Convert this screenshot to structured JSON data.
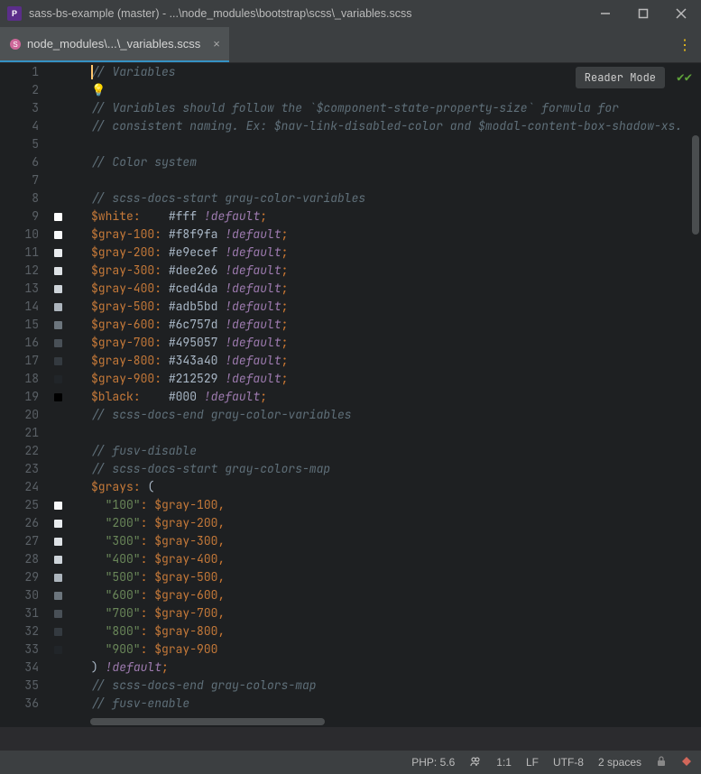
{
  "titlebar": {
    "title": "sass-bs-example (master) - ...\\node_modules\\bootstrap\\scss\\_variables.scss"
  },
  "tab": {
    "label": "node_modules\\...\\_variables.scss"
  },
  "editor": {
    "reader_mode_label": "Reader Mode",
    "lines": [
      {
        "n": 1,
        "type": "comment",
        "text": "// Variables",
        "caret": true
      },
      {
        "n": 2,
        "type": "bulb"
      },
      {
        "n": 3,
        "type": "comment",
        "text": "// Variables should follow the `$component-state-property-size` formula for"
      },
      {
        "n": 4,
        "type": "comment",
        "text": "// consistent naming. Ex: $nav-link-disabled-color and $modal-content-box-shadow-xs."
      },
      {
        "n": 5,
        "type": "blank"
      },
      {
        "n": 6,
        "type": "comment",
        "text": "// Color system"
      },
      {
        "n": 7,
        "type": "blank"
      },
      {
        "n": 8,
        "type": "comment",
        "text": "// scss-docs-start gray-color-variables"
      },
      {
        "n": 9,
        "type": "decl",
        "var": "$white",
        "val": "#fff",
        "swatch": "#ffffff",
        "wide": true
      },
      {
        "n": 10,
        "type": "decl",
        "var": "$gray-100",
        "val": "#f8f9fa",
        "swatch": "#f8f9fa"
      },
      {
        "n": 11,
        "type": "decl",
        "var": "$gray-200",
        "val": "#e9ecef",
        "swatch": "#e9ecef"
      },
      {
        "n": 12,
        "type": "decl",
        "var": "$gray-300",
        "val": "#dee2e6",
        "swatch": "#dee2e6"
      },
      {
        "n": 13,
        "type": "decl",
        "var": "$gray-400",
        "val": "#ced4da",
        "swatch": "#ced4da"
      },
      {
        "n": 14,
        "type": "decl",
        "var": "$gray-500",
        "val": "#adb5bd",
        "swatch": "#adb5bd"
      },
      {
        "n": 15,
        "type": "decl",
        "var": "$gray-600",
        "val": "#6c757d",
        "swatch": "#6c757d"
      },
      {
        "n": 16,
        "type": "decl",
        "var": "$gray-700",
        "val": "#495057",
        "swatch": "#495057"
      },
      {
        "n": 17,
        "type": "decl",
        "var": "$gray-800",
        "val": "#343a40",
        "swatch": "#343a40"
      },
      {
        "n": 18,
        "type": "decl",
        "var": "$gray-900",
        "val": "#212529",
        "swatch": "#212529"
      },
      {
        "n": 19,
        "type": "decl",
        "var": "$black",
        "val": "#000",
        "swatch": "#000000",
        "wide": true
      },
      {
        "n": 20,
        "type": "comment",
        "text": "// scss-docs-end gray-color-variables"
      },
      {
        "n": 21,
        "type": "blank"
      },
      {
        "n": 22,
        "type": "comment",
        "text": "// fusv-disable"
      },
      {
        "n": 23,
        "type": "comment",
        "text": "// scss-docs-start gray-colors-map"
      },
      {
        "n": 24,
        "type": "mapstart",
        "var": "$grays"
      },
      {
        "n": 25,
        "type": "mapentry",
        "key": "100",
        "val": "$gray-100",
        "swatch": "#f8f9fa",
        "comma": true
      },
      {
        "n": 26,
        "type": "mapentry",
        "key": "200",
        "val": "$gray-200",
        "swatch": "#e9ecef",
        "comma": true
      },
      {
        "n": 27,
        "type": "mapentry",
        "key": "300",
        "val": "$gray-300",
        "swatch": "#dee2e6",
        "comma": true
      },
      {
        "n": 28,
        "type": "mapentry",
        "key": "400",
        "val": "$gray-400",
        "swatch": "#ced4da",
        "comma": true
      },
      {
        "n": 29,
        "type": "mapentry",
        "key": "500",
        "val": "$gray-500",
        "swatch": "#adb5bd",
        "comma": true
      },
      {
        "n": 30,
        "type": "mapentry",
        "key": "600",
        "val": "$gray-600",
        "swatch": "#6c757d",
        "comma": true
      },
      {
        "n": 31,
        "type": "mapentry",
        "key": "700",
        "val": "$gray-700",
        "swatch": "#495057",
        "comma": true
      },
      {
        "n": 32,
        "type": "mapentry",
        "key": "800",
        "val": "$gray-800",
        "swatch": "#343a40",
        "comma": true
      },
      {
        "n": 33,
        "type": "mapentry",
        "key": "900",
        "val": "$gray-900",
        "swatch": "#212529",
        "comma": false
      },
      {
        "n": 34,
        "type": "mapend"
      },
      {
        "n": 35,
        "type": "comment",
        "text": "// scss-docs-end gray-colors-map"
      },
      {
        "n": 36,
        "type": "comment",
        "text": "// fusv-enable"
      }
    ]
  },
  "statusbar": {
    "php": "PHP: 5.6",
    "pos": "1:1",
    "eol": "LF",
    "encoding": "UTF-8",
    "indent": "2 spaces"
  }
}
